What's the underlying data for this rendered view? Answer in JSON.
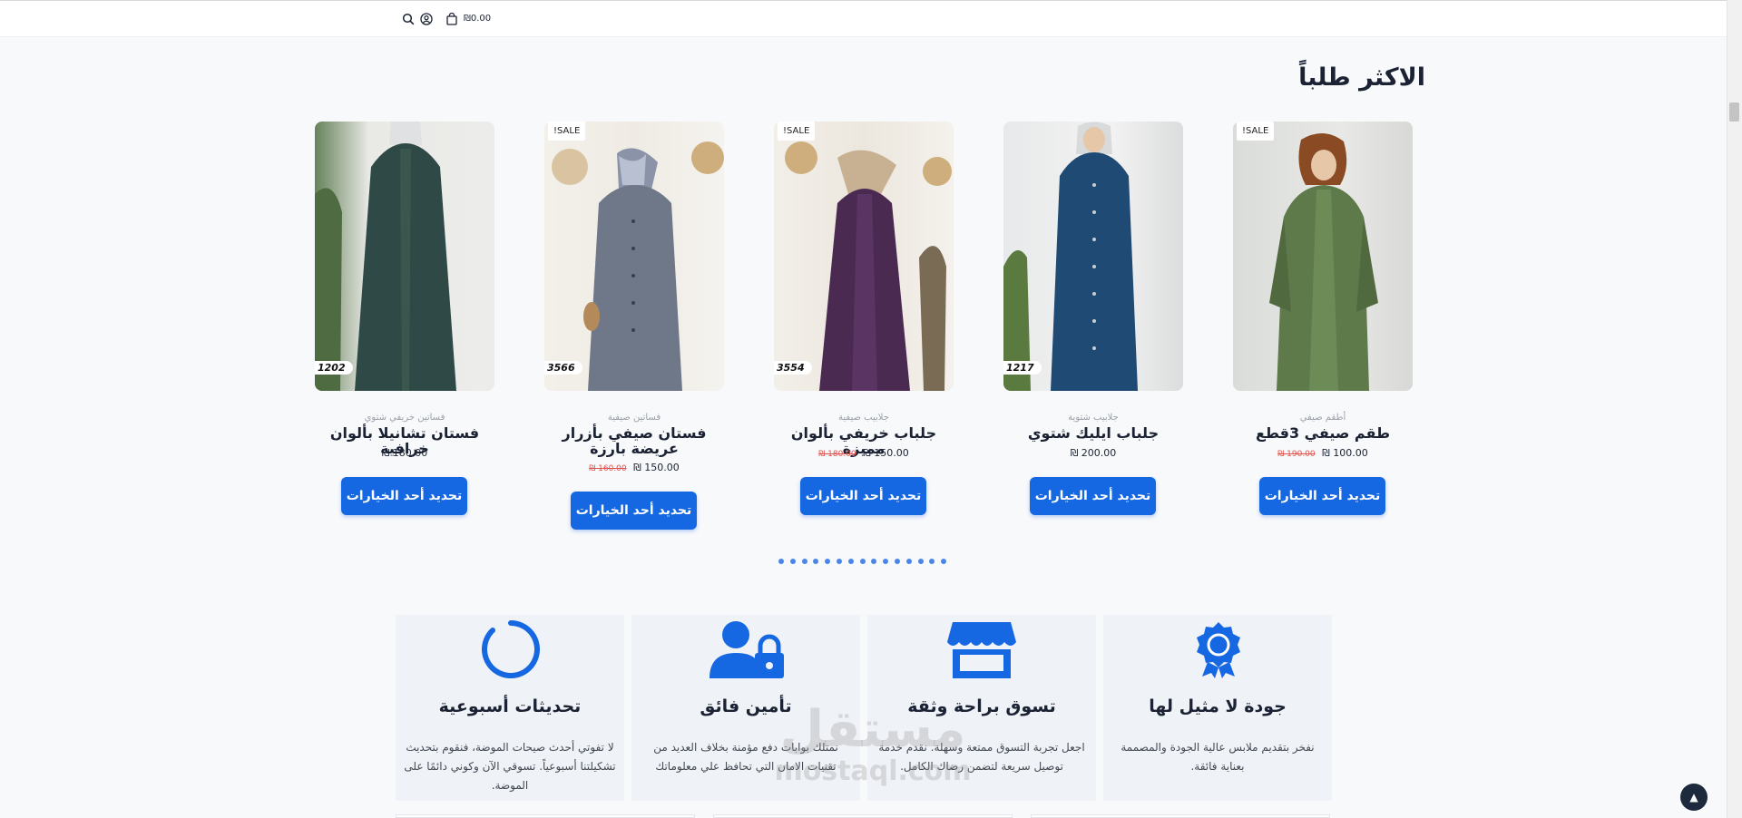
{
  "header": {
    "cart_total": "₪0.00",
    "icons": [
      "search-icon",
      "account-icon",
      "cart-icon"
    ]
  },
  "section_title": "الاكثر طلباً",
  "products": [
    {
      "category": "أطقم صيفي",
      "name": "طقم صيفي 3قطع",
      "price": "₪ 100.00",
      "old_price": "₪ 190.00",
      "sale": "!SALE",
      "code": "",
      "button": "تحديد أحد الخيارات"
    },
    {
      "category": "جلابيب شتوية",
      "name": "جلباب ايليك شتوي",
      "price": "₪ 200.00",
      "old_price": "",
      "sale": "",
      "code": "1217",
      "button": "تحديد أحد الخيارات"
    },
    {
      "category": "جلابيب صيفية",
      "name": "جلباب خريفي بألوان مميزة",
      "price": "₪ 150.00",
      "old_price": "₪ 180.00",
      "sale": "!SALE",
      "code": "3554",
      "button": "تحديد أحد الخيارات"
    },
    {
      "category": "فساتين صيفية",
      "name": "فستان صيفي بأزرار عريضة بارزة",
      "price": "₪ 150.00",
      "old_price": "₪ 160.00",
      "sale": "!SALE",
      "code": "3566",
      "button": "تحديد أحد الخيارات"
    },
    {
      "category": "فساتين خريفي شتوي",
      "name": "فستان تشانيلا بألوان خرافية",
      "price": "₪ 180.00",
      "old_price": "",
      "sale": "",
      "code": "1202",
      "button": "تحديد أحد الخيارات"
    }
  ],
  "carousel_dot_count": 15,
  "features": [
    {
      "icon": "badge-icon",
      "title": "جودة لا مثيل لها",
      "desc": "نفخر بتقديم ملابس عالية الجودة والمصممة بعناية فائقة."
    },
    {
      "icon": "store-icon",
      "title": "تسوق براحة وثقة",
      "desc": "اجعل تجربة التسوق ممتعة وسهلة. نقدم خدمة توصيل سريعة لتضمن رضاك الكامل."
    },
    {
      "icon": "user-lock-icon",
      "title": "تأمين فائق",
      "desc": "نمتلك بوابات دفع مؤمنة بخلاف العديد من تقنيات الامان التي تحافظ علي معلوماتك"
    },
    {
      "icon": "refresh-icon",
      "title": "تحديثات أسبوعية",
      "desc": "لا تفوتي أحدث صيحات الموضة، فنقوم بتحديث تشكيلتنا أسبوعياً. تسوقي الآن وكوني دائمًا على الموضة."
    }
  ],
  "watermark": {
    "line1": "مستقل",
    "line2": "mostaql.com"
  },
  "colors": {
    "accent": "#1668e2",
    "sale_old": "#e0514b",
    "text": "#1a2233"
  }
}
